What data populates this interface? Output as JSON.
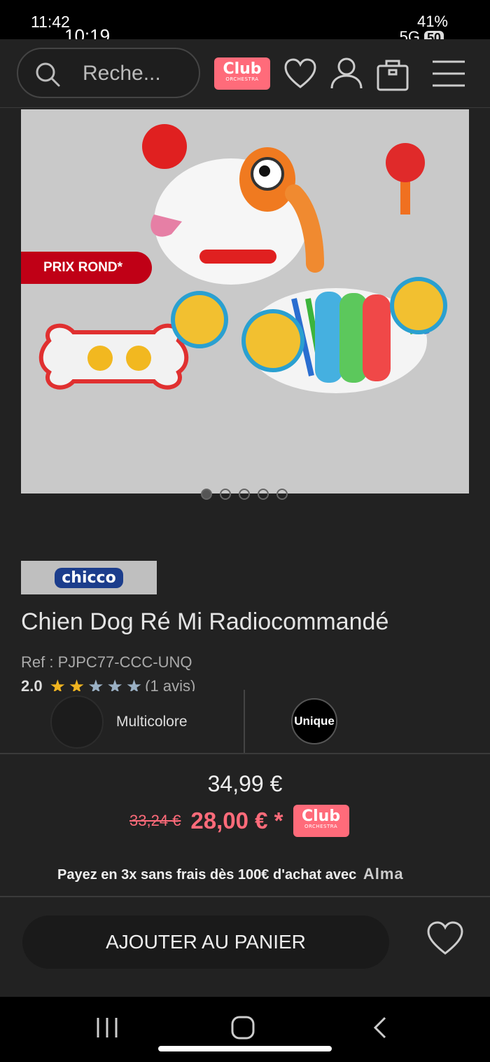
{
  "status_bar": {
    "time_back": "11:42",
    "time_front": "10:19",
    "battery": "41%",
    "network": "5G",
    "battery_badge": "50"
  },
  "header": {
    "search_placeholder": "Reche...",
    "club_label": "Club",
    "club_sub": "ORCHESTRA",
    "icons": [
      "search-icon",
      "heart-icon",
      "user-icon",
      "bag-icon",
      "menu-icon"
    ]
  },
  "gallery": {
    "promo_badge": "PRIX ROND*",
    "dots_count": 5,
    "active_dot": 0
  },
  "product": {
    "brand": "chicco",
    "title": "Chien Dog Ré Mi Radiocommandé",
    "ref": "Ref : PJPC77-CCC-UNQ",
    "rating_value": "2.0",
    "rating_stars": 2,
    "rating_max": 5,
    "reviews": "(1 avis)",
    "color_label": "Multicolore",
    "size_label": "Unique"
  },
  "pricing": {
    "price": "34,99 €",
    "old_price": "33,24 €",
    "club_price": "28,00 € *",
    "club_label": "Club",
    "club_sub": "ORCHESTRA",
    "installments": "Payez en 3x sans frais dès 100€ d'achat avec",
    "installments_brand": "Alma"
  },
  "actions": {
    "add_to_cart": "AJOUTER AU PANIER"
  },
  "colors": {
    "accent": "#ff6b7a",
    "promo": "#c00016",
    "background": "#222222"
  }
}
